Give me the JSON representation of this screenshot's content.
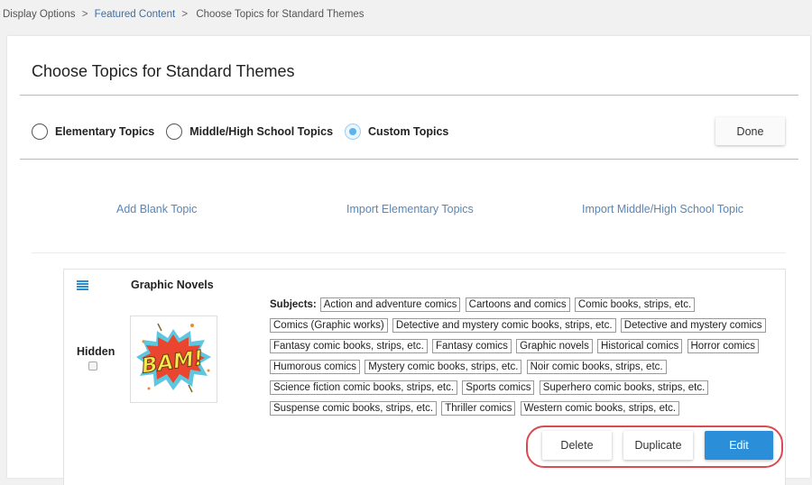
{
  "breadcrumb": {
    "items": [
      {
        "label": "Display Options",
        "link": false
      },
      {
        "label": "Featured Content",
        "link": true
      },
      {
        "label": "Choose Topics for Standard Themes",
        "link": false
      }
    ],
    "separator": ">"
  },
  "page": {
    "title": "Choose Topics for Standard Themes"
  },
  "topic_set": {
    "options": [
      {
        "label": "Elementary Topics",
        "checked": false
      },
      {
        "label": "Middle/High School Topics",
        "checked": false
      },
      {
        "label": "Custom Topics",
        "checked": true
      }
    ],
    "done_label": "Done"
  },
  "actions": {
    "add_blank": "Add Blank Topic",
    "import_elementary": "Import Elementary Topics",
    "import_middle_high": "Import Middle/High School Topic"
  },
  "topic": {
    "title": "Graphic Novels",
    "hidden_label": "Hidden",
    "hidden_checked": false,
    "image_alt": "BAM!",
    "subjects_label": "Subjects:",
    "subjects": [
      "Action and adventure comics",
      "Cartoons and comics",
      "Comic books, strips, etc.",
      "Comics (Graphic works)",
      "Detective and mystery comic books, strips, etc.",
      "Detective and mystery comics",
      "Fantasy comic books, strips, etc.",
      "Fantasy comics",
      "Graphic novels",
      "Historical comics",
      "Horror comics",
      "Humorous comics",
      "Mystery comic books, strips, etc.",
      "Noir comic books, strips, etc.",
      "Science fiction comic books, strips, etc.",
      "Sports comics",
      "Superhero comic books, strips, etc.",
      "Suspense comic books, strips, etc.",
      "Thriller comics",
      "Western comic books, strips, etc."
    ],
    "buttons": {
      "delete": "Delete",
      "duplicate": "Duplicate",
      "edit": "Edit"
    }
  },
  "colors": {
    "link": "#3d6fa8",
    "primary": "#2a8fd8",
    "highlight_ring": "#d94a52",
    "radio_selected": "#5ab4ee"
  }
}
